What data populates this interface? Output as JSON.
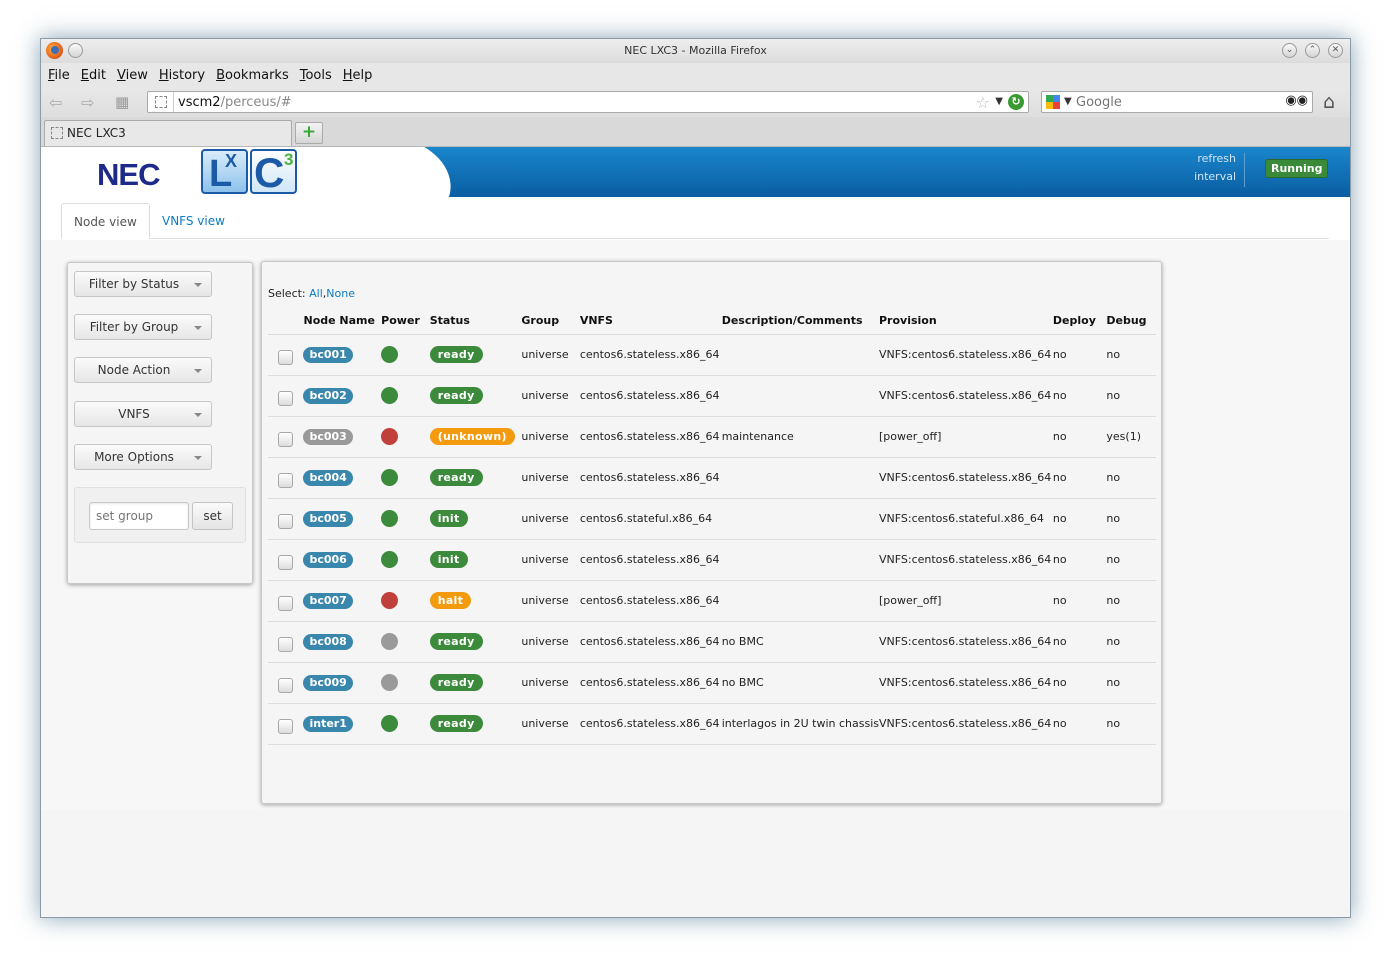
{
  "window": {
    "title": "NEC LXC3 - Mozilla Firefox"
  },
  "menu": [
    "File",
    "Edit",
    "View",
    "History",
    "Bookmarks",
    "Tools",
    "Help"
  ],
  "navbar": {
    "url_host": "vscm2",
    "url_path": "/perceus/#",
    "search_placeholder": "Google"
  },
  "tab": {
    "label": "NEC LXC3",
    "new_tab": "+"
  },
  "banner": {
    "logo_text": "NEC",
    "lxc_l": "L",
    "lxc_x": "X",
    "lxc_c": "C",
    "lxc_3": "3",
    "refresh_line1": "refresh",
    "refresh_line2": "interval",
    "status": "Running"
  },
  "view_tabs": {
    "node_view": "Node view",
    "vnfs_view": "VNFS view"
  },
  "sidebar": {
    "filter_status": "Filter by Status",
    "filter_group": "Filter by Group",
    "node_action": "Node Action",
    "vnfs": "VNFS",
    "more_options": "More Options",
    "set_group_placeholder": "set group",
    "set_button": "set"
  },
  "table": {
    "select_label": "Select:",
    "select_all": "All",
    "select_comma": ",",
    "select_none": "None",
    "headers": {
      "node_name": "Node Name",
      "power": "Power",
      "status": "Status",
      "group": "Group",
      "vnfs": "VNFS",
      "description": "Description/Comments",
      "provision": "Provision",
      "deploy": "Deploy",
      "debug": "Debug"
    },
    "rows": [
      {
        "name": "bc001",
        "node_color": "on",
        "power": "#3c8a3c",
        "status": "ready",
        "status_color": "#3c8a3c",
        "group": "universe",
        "vnfs": "centos6.stateless.x86_64",
        "desc": "",
        "provision": "VNFS:centos6.stateless.x86_64",
        "deploy": "no",
        "debug": "no"
      },
      {
        "name": "bc002",
        "node_color": "on",
        "power": "#3c8a3c",
        "status": "ready",
        "status_color": "#3c8a3c",
        "group": "universe",
        "vnfs": "centos6.stateless.x86_64",
        "desc": "",
        "provision": "VNFS:centos6.stateless.x86_64",
        "deploy": "no",
        "debug": "no"
      },
      {
        "name": "bc003",
        "node_color": "off",
        "power": "#c0413b",
        "status": "(unknown)",
        "status_color": "#f39a0e",
        "group": "universe",
        "vnfs": "centos6.stateless.x86_64",
        "desc": "maintenance",
        "provision": "[power_off]",
        "deploy": "no",
        "debug": "yes(1)"
      },
      {
        "name": "bc004",
        "node_color": "on",
        "power": "#3c8a3c",
        "status": "ready",
        "status_color": "#3c8a3c",
        "group": "universe",
        "vnfs": "centos6.stateless.x86_64",
        "desc": "",
        "provision": "VNFS:centos6.stateless.x86_64",
        "deploy": "no",
        "debug": "no"
      },
      {
        "name": "bc005",
        "node_color": "on",
        "power": "#3c8a3c",
        "status": "init",
        "status_color": "#3c8a3c",
        "group": "universe",
        "vnfs": "centos6.stateful.x86_64",
        "desc": "",
        "provision": "VNFS:centos6.stateful.x86_64",
        "deploy": "no",
        "debug": "no"
      },
      {
        "name": "bc006",
        "node_color": "on",
        "power": "#3c8a3c",
        "status": "init",
        "status_color": "#3c8a3c",
        "group": "universe",
        "vnfs": "centos6.stateless.x86_64",
        "desc": "",
        "provision": "VNFS:centos6.stateless.x86_64",
        "deploy": "no",
        "debug": "no"
      },
      {
        "name": "bc007",
        "node_color": "on",
        "power": "#c0413b",
        "status": "halt",
        "status_color": "#f39a0e",
        "group": "universe",
        "vnfs": "centos6.stateless.x86_64",
        "desc": "",
        "provision": "[power_off]",
        "deploy": "no",
        "debug": "no"
      },
      {
        "name": "bc008",
        "node_color": "on",
        "power": "#9a9a9a",
        "status": "ready",
        "status_color": "#3c8a3c",
        "group": "universe",
        "vnfs": "centos6.stateless.x86_64",
        "desc": "no BMC",
        "provision": "VNFS:centos6.stateless.x86_64",
        "deploy": "no",
        "debug": "no"
      },
      {
        "name": "bc009",
        "node_color": "on",
        "power": "#9a9a9a",
        "status": "ready",
        "status_color": "#3c8a3c",
        "group": "universe",
        "vnfs": "centos6.stateless.x86_64",
        "desc": "no BMC",
        "provision": "VNFS:centos6.stateless.x86_64",
        "deploy": "no",
        "debug": "no"
      },
      {
        "name": "inter1",
        "node_color": "on",
        "power": "#3c8a3c",
        "status": "ready",
        "status_color": "#3c8a3c",
        "group": "universe",
        "vnfs": "centos6.stateless.x86_64",
        "desc": "interlagos in 2U twin chassis",
        "provision": "VNFS:centos6.stateless.x86_64",
        "deploy": "no",
        "debug": "no"
      }
    ]
  },
  "colors": {
    "banner_blue": "#0a6fb6",
    "link_blue": "#0a7cc2",
    "running_green": "#3a8a3a"
  }
}
